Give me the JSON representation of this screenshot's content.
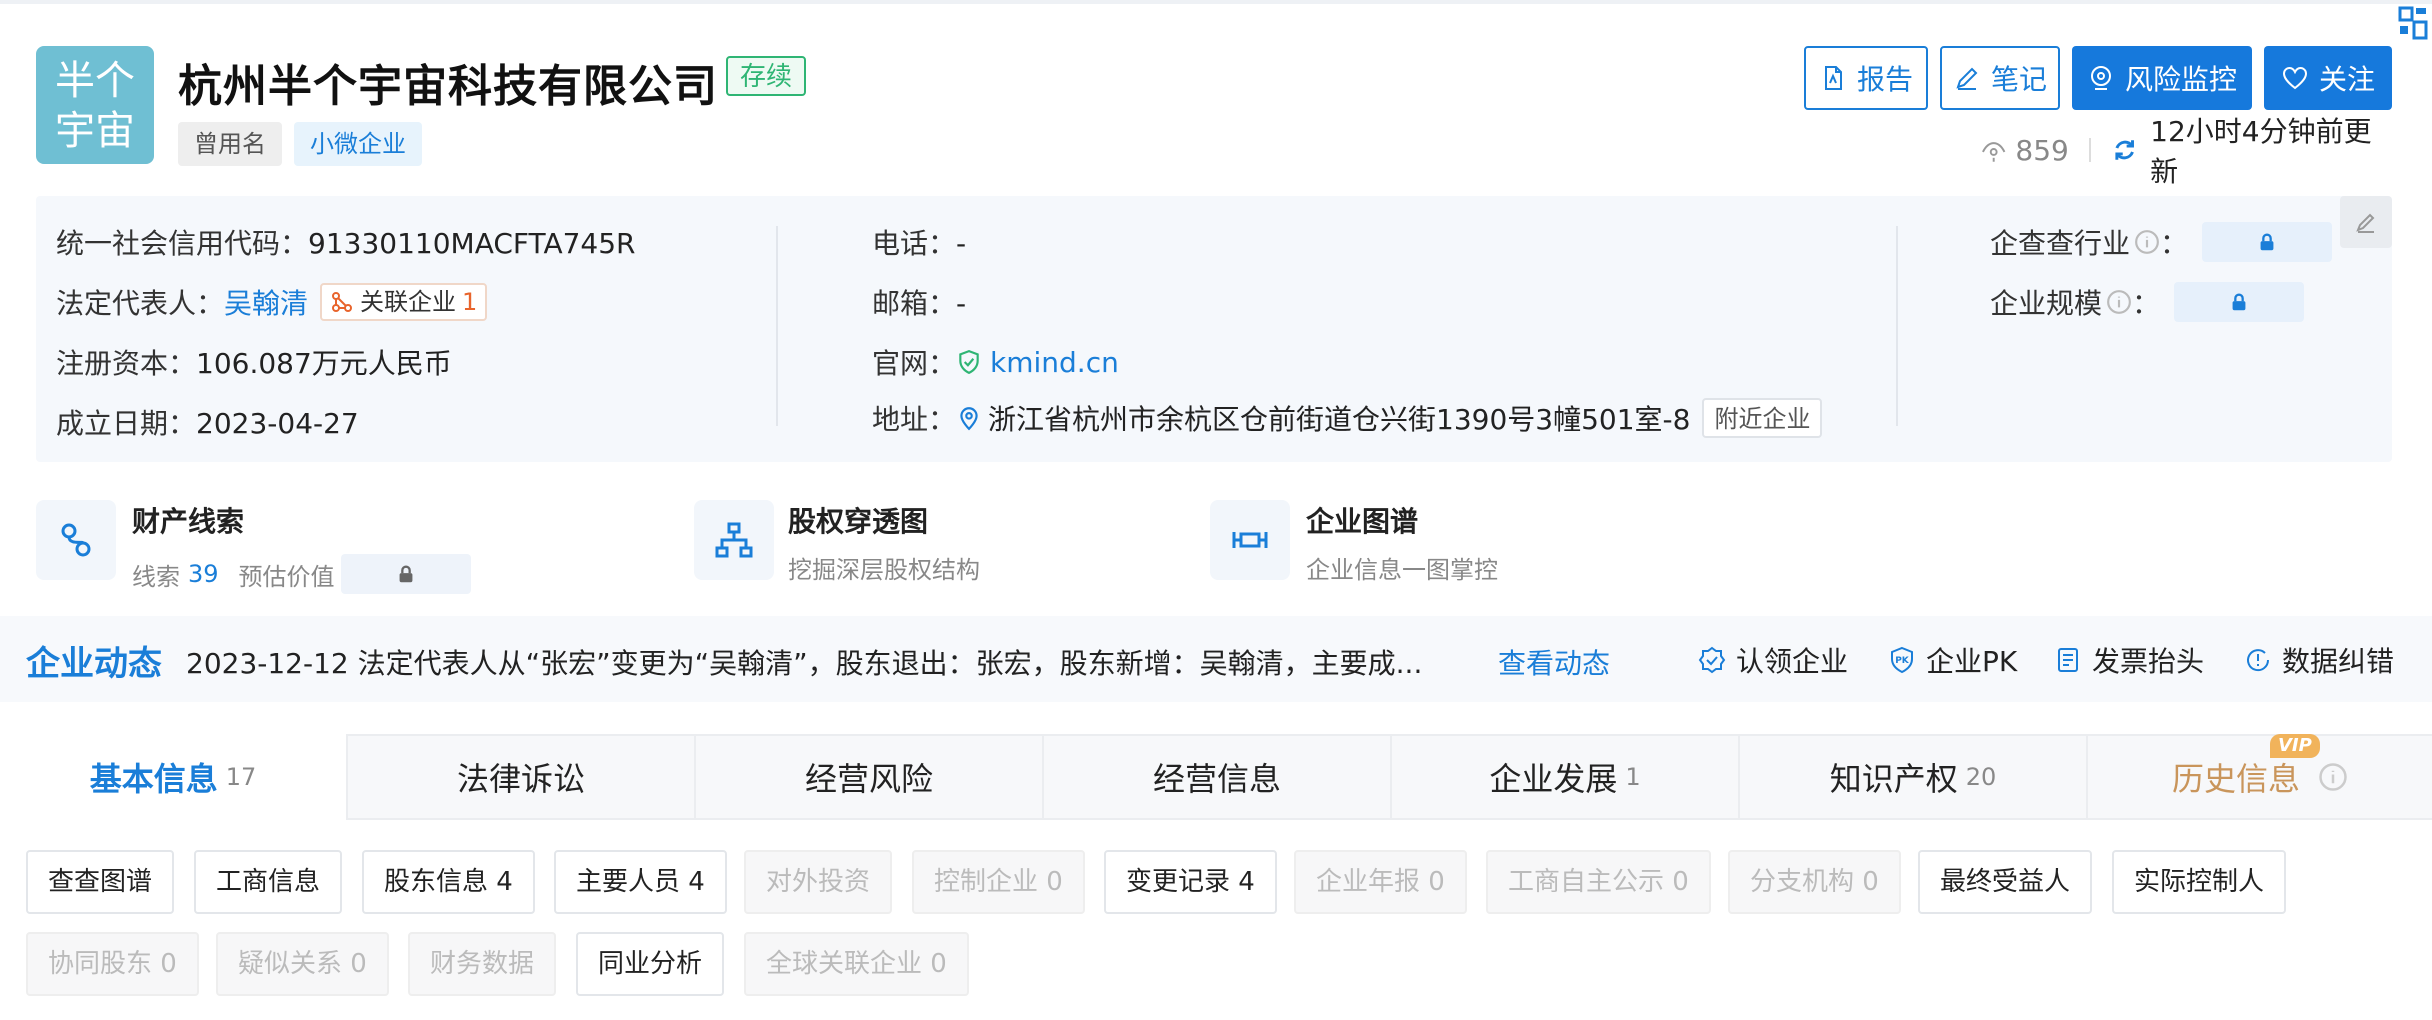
{
  "company": {
    "logo_text": "半个宇宙",
    "name": "杭州半个宇宙科技有限公司",
    "status": "存续",
    "tags": [
      "曾用名",
      "小微企业"
    ]
  },
  "actions": {
    "report": "报告",
    "note": "笔记",
    "risk_monitor": "风险监控",
    "follow": "关注"
  },
  "meta": {
    "views": "859",
    "updated": "12小时4分钟前更新"
  },
  "info": {
    "credit_code_label": "统一社会信用代码：",
    "credit_code": "91330110MACFTA745R",
    "legal_rep_label": "法定代表人：",
    "legal_rep": "吴翰清",
    "assoc_label": "关联企业",
    "assoc_count": "1",
    "capital_label": "注册资本：",
    "capital": "106.087万元人民币",
    "founded_label": "成立日期：",
    "founded": "2023-04-27",
    "phone_label": "电话：",
    "phone": "-",
    "email_label": "邮箱：",
    "email": "-",
    "website_label": "官网：",
    "website": "kmind.cn",
    "address_label": "地址：",
    "address": "浙江省杭州市余杭区仓前街道仓兴街1390号3幢501室-8",
    "nearby": "附近企业",
    "industry_label": "企查查行业",
    "scale_label": "企业规模",
    "colon": "："
  },
  "features": [
    {
      "title": "财产线索",
      "sub_prefix": "线索",
      "count": "39",
      "sub_suffix": "预估价值"
    },
    {
      "title": "股权穿透图",
      "sub": "挖掘深层股权结构"
    },
    {
      "title": "企业图谱",
      "sub": "企业信息一图掌控"
    }
  ],
  "dynamics": {
    "title": "企业动态",
    "text": "2023-12-12 法定代表人从“张宏”变更为“吴翰清”，股东退出：张宏，股东新增：吴翰清，主要成...",
    "link": "查看动态",
    "actions": [
      "认领企业",
      "企业PK",
      "发票抬头",
      "数据纠错"
    ]
  },
  "tabs": [
    {
      "label": "基本信息",
      "count": "17"
    },
    {
      "label": "法律诉讼",
      "count": ""
    },
    {
      "label": "经营风险",
      "count": ""
    },
    {
      "label": "经营信息",
      "count": ""
    },
    {
      "label": "企业发展",
      "count": "1"
    },
    {
      "label": "知识产权",
      "count": "20"
    },
    {
      "label": "历史信息",
      "count": ""
    }
  ],
  "vip_badge": "VIP",
  "subtags": [
    "查查图谱",
    "工商信息",
    "股东信息 4",
    "主要人员 4",
    "对外投资",
    "控制企业 0",
    "变更记录 4",
    "企业年报 0",
    "工商自主公示 0",
    "分支机构 0",
    "最终受益人",
    "实际控制人",
    "协同股东 0",
    "疑似关系 0",
    "财务数据",
    "同业分析",
    "全球关联企业 0"
  ],
  "colors": {
    "accent": "#1a7ed8",
    "status_green": "#2fb574",
    "history_gold": "#c9955b"
  }
}
